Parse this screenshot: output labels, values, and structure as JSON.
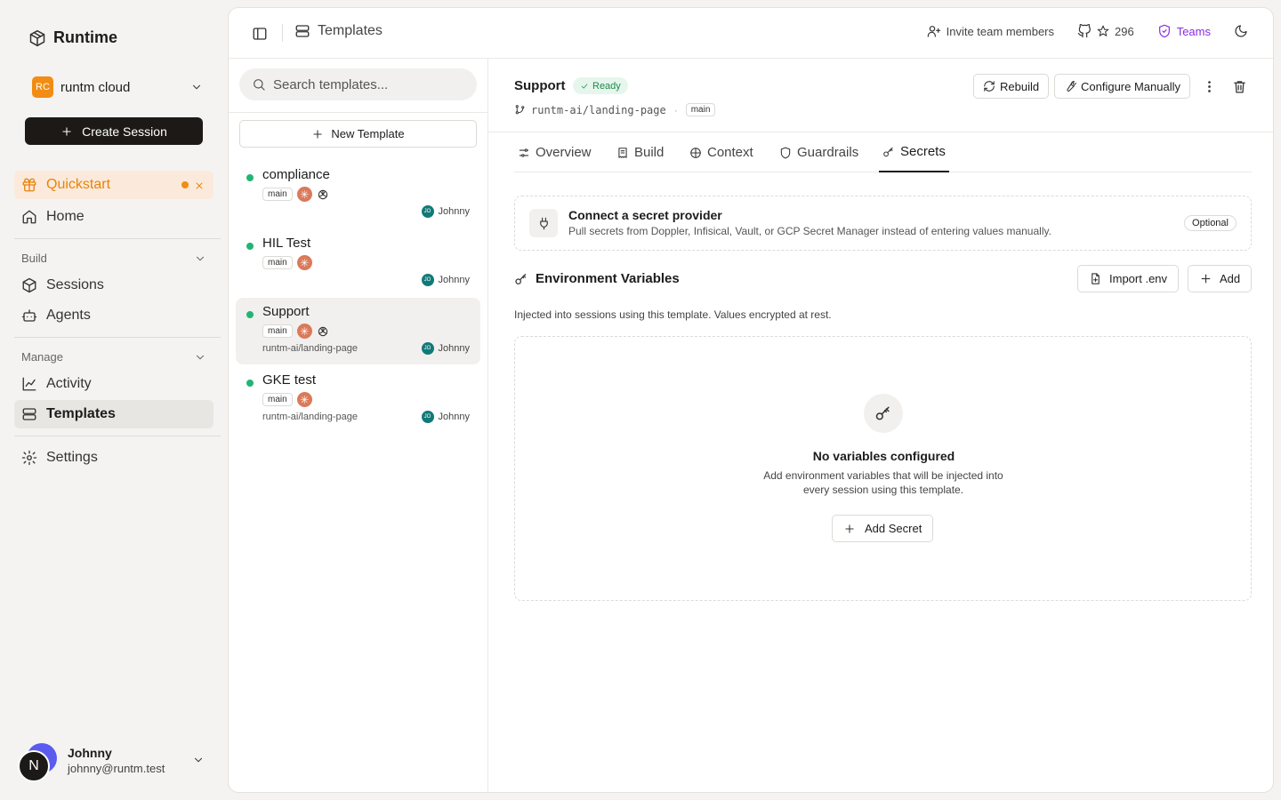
{
  "sidebar": {
    "brand": "Runtime",
    "org": {
      "badge": "RC",
      "name": "runtm cloud"
    },
    "create_session": "Create Session",
    "quickstart": "Quickstart",
    "home": "Home",
    "build_section": "Build",
    "sessions": "Sessions",
    "agents": "Agents",
    "manage_section": "Manage",
    "activity": "Activity",
    "templates": "Templates",
    "settings": "Settings",
    "user": {
      "initial": "N",
      "name": "Johnny",
      "email": "johnny@runtm.test"
    }
  },
  "topbar": {
    "title": "Templates",
    "invite": "Invite team members",
    "stars": "296",
    "teams": "Teams"
  },
  "list": {
    "search_placeholder": "Search templates...",
    "new_template": "New Template",
    "templates": [
      {
        "name": "compliance",
        "branch": "main",
        "repo": "",
        "owner_initials": "JO",
        "owner": "Johnny"
      },
      {
        "name": "HIL Test",
        "branch": "main",
        "repo": "",
        "owner_initials": "JO",
        "owner": "Johnny"
      },
      {
        "name": "Support",
        "branch": "main",
        "repo": "runtm-ai/landing-page",
        "owner_initials": "JO",
        "owner": "Johnny"
      },
      {
        "name": "GKE test",
        "branch": "main",
        "repo": "runtm-ai/landing-page",
        "owner_initials": "JO",
        "owner": "Johnny"
      }
    ]
  },
  "detail": {
    "title": "Support",
    "status": "Ready",
    "repo": "runtm-ai/landing-page",
    "separator": "·",
    "branch": "main",
    "rebuild": "Rebuild",
    "configure": "Configure Manually",
    "tabs": [
      "Overview",
      "Build",
      "Context",
      "Guardrails",
      "Secrets"
    ],
    "active_tab": "Secrets",
    "provider": {
      "title": "Connect a secret provider",
      "subtitle": "Pull secrets from Doppler, Infisical, Vault, or GCP Secret Manager instead of entering values manually.",
      "badge": "Optional"
    },
    "env": {
      "title": "Environment Variables",
      "import": "Import .env",
      "add": "Add",
      "description": "Injected into sessions using this template. Values encrypted at rest.",
      "empty_title": "No variables configured",
      "empty_subtitle": "Add environment variables that will be injected into every session using this template.",
      "add_secret": "Add Secret"
    }
  },
  "colors": {
    "accent_orange": "#f28c12",
    "quickstart_bg": "#fbeadb",
    "status_green": "#22b573",
    "teams_purple": "#8a2be2",
    "dark": "#1c1917"
  }
}
